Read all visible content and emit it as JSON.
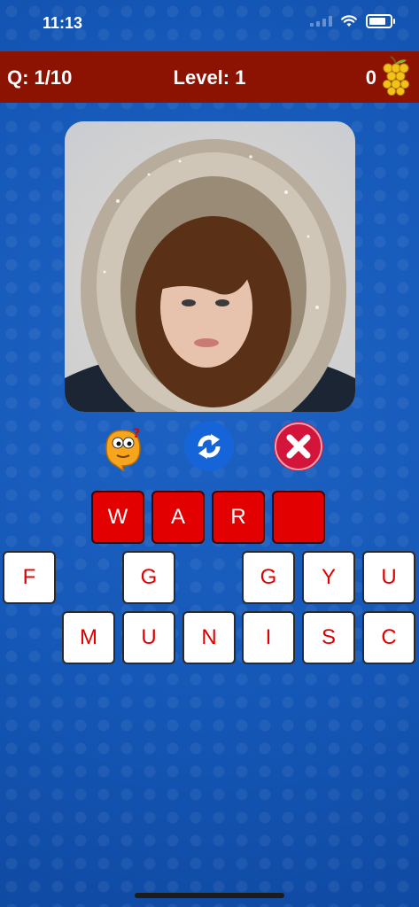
{
  "status_bar": {
    "time": "11:13"
  },
  "header": {
    "question": "Q: 1/10",
    "level": "Level: 1",
    "coins": "0"
  },
  "actions": {
    "hint_icon": "hint-mascot-icon",
    "shuffle_icon": "shuffle-icon",
    "remove_icon": "close-icon"
  },
  "answer": [
    "W",
    "A",
    "R",
    ""
  ],
  "keyboard": {
    "row1": [
      "F",
      "",
      "G",
      "",
      "G",
      "Y",
      "U"
    ],
    "row2": [
      "",
      "M",
      "U",
      "N",
      "I",
      "S",
      "C"
    ]
  },
  "colors": {
    "header": "#8c1201",
    "answer_slot": "#e30000",
    "key_text": "#e00000",
    "shuffle": "#1565d8",
    "remove": "#d3153b"
  }
}
